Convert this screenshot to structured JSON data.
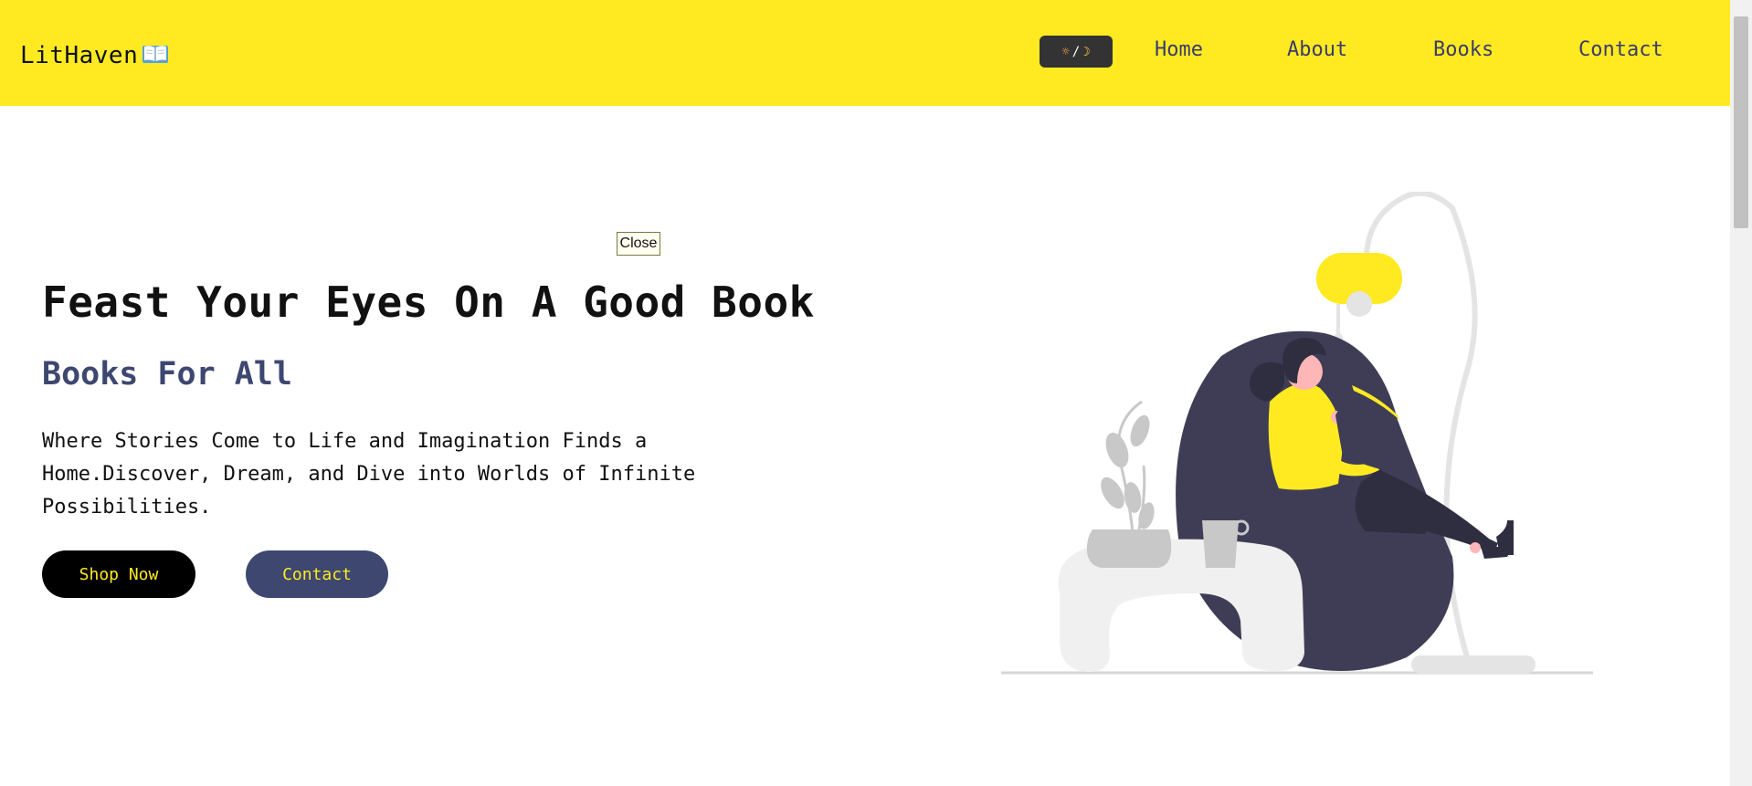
{
  "navbar": {
    "logo_text": "LitHaven",
    "theme_toggle": {
      "sun": "☼",
      "separator": "/",
      "moon": "☽"
    },
    "links": [
      "Home",
      "About",
      "Books",
      "Contact"
    ]
  },
  "overlay": {
    "close_label": "Close"
  },
  "hero": {
    "title": "Feast Your Eyes On A Good Book",
    "subtitle": "Books For All",
    "text": "Where Stories Come to Life and Imagination Finds a Home.Discover, Dream, and Dive into Worlds of Infinite Possibilities.",
    "buttons": {
      "shop": "Shop Now",
      "contact": "Contact"
    }
  },
  "colors": {
    "navbar_bg": "#ffea22",
    "accent_yellow": "#ffea22",
    "navy": "#3d4770",
    "dark": "#3f3d56"
  },
  "icons": [
    "open-book-icon",
    "sun-icon",
    "moon-icon"
  ]
}
